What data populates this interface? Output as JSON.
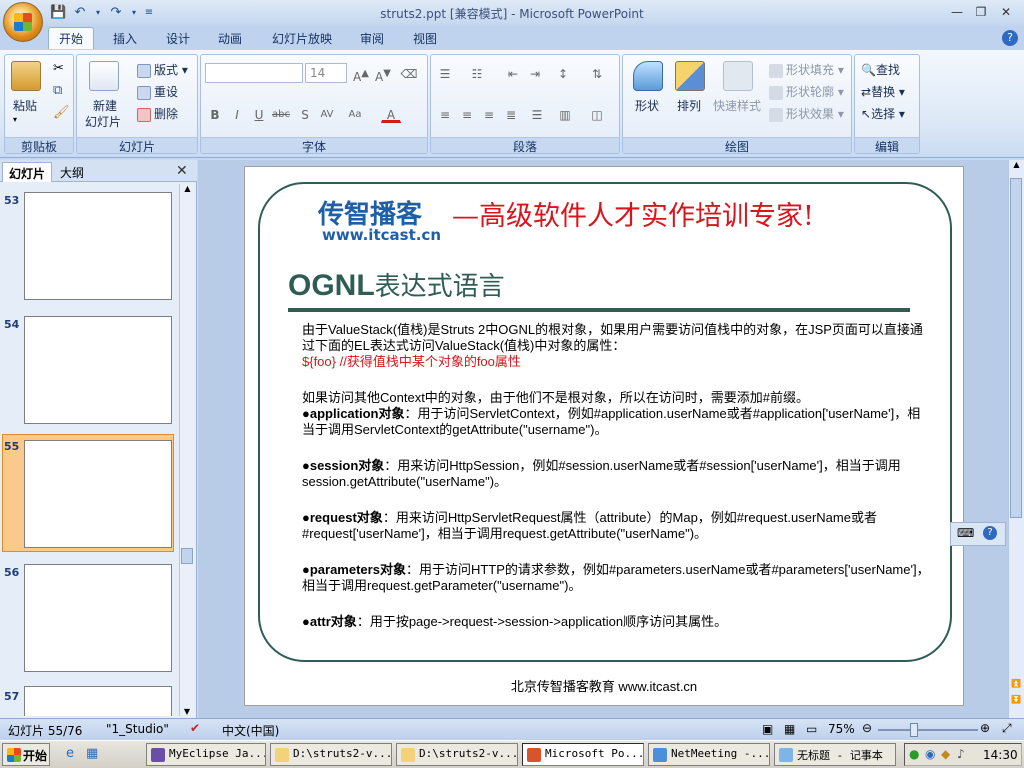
{
  "window": {
    "title": "struts2.ppt [兼容模式] - Microsoft PowerPoint"
  },
  "tabs": [
    "开始",
    "插入",
    "设计",
    "动画",
    "幻灯片放映",
    "审阅",
    "视图"
  ],
  "ribbon": {
    "clipboard": {
      "label": "剪贴板",
      "paste": "粘贴"
    },
    "slides": {
      "label": "幻灯片",
      "new_slide": "新建",
      "new_slide2": "幻灯片",
      "layout": "版式",
      "reset": "重设",
      "delete": "删除"
    },
    "font": {
      "label": "字体",
      "size": "14"
    },
    "paragraph": {
      "label": "段落"
    },
    "drawing": {
      "label": "绘图",
      "shapes": "形状",
      "arrange": "排列",
      "quick_styles": "快速样式",
      "fill": "形状填充",
      "outline": "形状轮廓",
      "effects": "形状效果"
    },
    "editing": {
      "label": "编辑",
      "find": "查找",
      "replace": "替换",
      "select": "选择"
    }
  },
  "left_pane": {
    "tab_slides": "幻灯片",
    "tab_outline": "大纲",
    "numbers": [
      "53",
      "54",
      "55",
      "56",
      "57"
    ]
  },
  "slide": {
    "logo": "传智播客",
    "logo_url": "www.itcast.cn",
    "slogan": "—高级软件人才实作培训专家!",
    "heading_en": "OGNL",
    "heading_cn": "表达式语言",
    "p1": "由于ValueStack(值栈)是Struts 2中OGNL的根对象，如果用户需要访问值栈中的对象，在JSP页面可以直接通过下面的EL表达式访问ValueStack(值栈)中对象的属性：",
    "p1_red": "${foo} //获得值栈中某个对象的foo属性",
    "p2": "如果访问其他Context中的对象，由于他们不是根对象，所以在访问时，需要添加#前缀。",
    "b1_term": "●application对象",
    "b1_text": "：用于访问ServletContext，例如#application.userName或者#application['userName']，相当于调用ServletContext的getAttribute(\"username\")。",
    "b2_term": "●session对象",
    "b2_text": "：用来访问HttpSession，例如#session.userName或者#session['userName']，相当于调用session.getAttribute(\"userName\")。",
    "b3_term": "●request对象",
    "b3_text": "：用来访问HttpServletRequest属性（attribute）的Map，例如#request.userName或者#request['userName']，相当于调用request.getAttribute(\"userName\")。",
    "b4_term": "●parameters对象",
    "b4_text": "：用于访问HTTP的请求参数，例如#parameters.userName或者#parameters['userName']，相当于调用request.getParameter(\"username\")。",
    "b5_term": "●attr对象",
    "b5_text": "：用于按page->request->session->application顺序访问其属性。",
    "footer": "北京传智播客教育 www.itcast.cn"
  },
  "status": {
    "slide_num": "幻灯片 55/76",
    "theme": "\"1_Studio\"",
    "lang": "中文(中国)",
    "zoom": "75%"
  },
  "taskbar": {
    "start": "开始",
    "items": [
      "MyEclipse Ja...",
      "D:\\struts2-v...",
      "D:\\struts2-v...",
      "Microsoft Po...",
      "NetMeeting -...",
      "无标题 - 记事本"
    ],
    "time": "14:30"
  },
  "colors": {
    "accent": "#2f5d55",
    "red": "#d8141c",
    "logo_blue": "#1f5fa8",
    "logo_orange": "#f07a12"
  }
}
